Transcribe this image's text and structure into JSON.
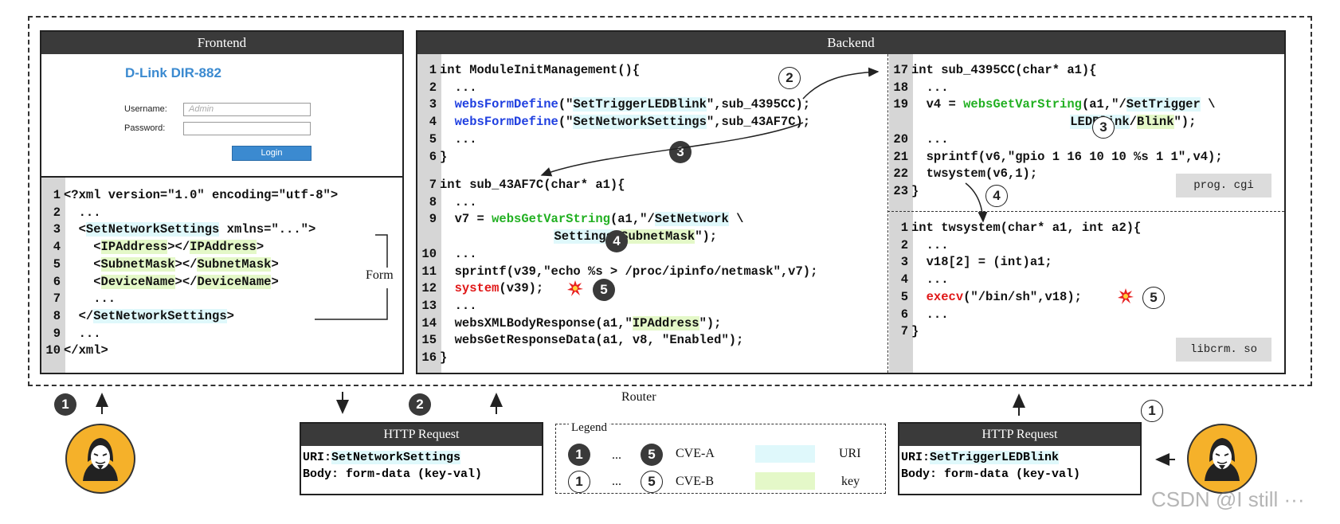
{
  "frontend": {
    "title": "Frontend",
    "brand": "D-Link DIR-882",
    "username_label": "Username:",
    "username_placeholder": "Admin",
    "password_label": "Password:",
    "login_button": "Login",
    "form_label": "Form"
  },
  "backend": {
    "title": "Backend"
  },
  "file_tags": {
    "prog": "prog. cgi",
    "lib": "libcrm. so"
  },
  "router_label": "Router",
  "request_left": {
    "title": "HTTP Request",
    "uri_label": "URI:",
    "uri_value": "SetNetworkSettings",
    "body": "Body: form-data (key-val)"
  },
  "request_right": {
    "title": "HTTP Request",
    "uri_label": "URI:",
    "uri_value": "SetTriggerLEDBlink",
    "body": "Body: form-data (key-val)"
  },
  "legend": {
    "title": "Legend",
    "cve_a": "CVE-A",
    "cve_b": "CVE-B",
    "uri": "URI",
    "key": "key",
    "ellipsis": "...",
    "start_num": "1",
    "end_num": "5"
  },
  "watermark": "CSDN @I still ···",
  "markers": {
    "n1": "1",
    "n2": "2",
    "n3": "3",
    "n4": "4",
    "n5": "5"
  },
  "colors": {
    "header": "#3a3a3a",
    "gutter": "#d6d6d6",
    "uri_highlight": "#dff8fb",
    "key_highlight": "#e4f8c8",
    "api_blue": "#1f3fe0",
    "api_green": "#22b022",
    "danger_red": "#e01818",
    "attacker": "#f5b12a"
  }
}
